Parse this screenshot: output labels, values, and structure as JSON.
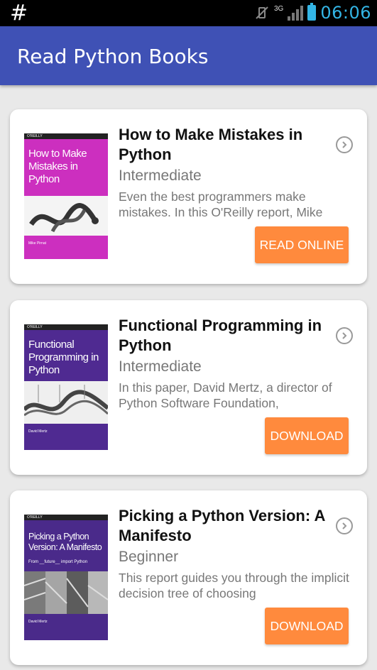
{
  "status_bar": {
    "left_symbol": "#",
    "network": "3G",
    "time": "06:06"
  },
  "app_bar": {
    "title": "Read Python Books"
  },
  "books": [
    {
      "title": "How to Make Mistakes in Python",
      "level": "Intermediate",
      "description": "Even the best programmers make mistakes. In this O'Reilly report, Mike",
      "action": "READ ONLINE",
      "cover": {
        "brand": "O'REILLY",
        "title": "How to Make Mistakes in Python",
        "author": "Mike Pirnat",
        "color": "#cc2fbf"
      }
    },
    {
      "title": "Functional Programming in Python",
      "level": "Intermediate",
      "description": "In this paper, David Mertz, a director of Python Software Foundation,",
      "action": "DOWNLOAD",
      "cover": {
        "brand": "O'REILLY",
        "title": "Functional Programming in Python",
        "author": "David Mertz",
        "color": "#4f2a91"
      }
    },
    {
      "title": "Picking a Python Version: A Manifesto",
      "level": "Beginner",
      "description": "This report guides you through the implicit decision tree of choosing",
      "action": "DOWNLOAD",
      "cover": {
        "brand": "O'REILLY",
        "title": "Picking a Python Version: A Manifesto",
        "subtitle": "From __future__ import Python",
        "author": "David Mertz",
        "color": "#4a2a8a"
      }
    }
  ],
  "colors": {
    "app_bar": "#3f51b5",
    "button": "#ff8a3d",
    "background": "#e9e9e9"
  }
}
